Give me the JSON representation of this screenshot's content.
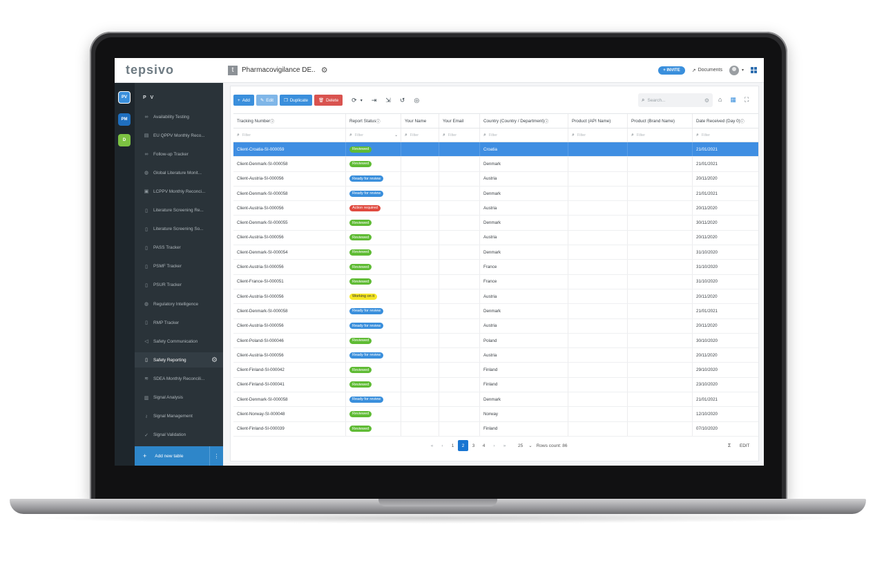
{
  "app": {
    "logo": "tepsivo",
    "badge_letter": "t",
    "title": "Pharmacovigilance DE..",
    "invite_label": "+ INVITE",
    "documents_label": "Documents"
  },
  "rail": [
    {
      "label": "PV",
      "color": "#3a8fdc"
    },
    {
      "label": "PM",
      "color": "#1f6fbf"
    },
    {
      "label": "D",
      "color": "#7cc242"
    }
  ],
  "sidebar": {
    "heading": "P V",
    "items": [
      {
        "label": "Availability Testing",
        "icon": "link-icon"
      },
      {
        "label": "EU QPPV Monthly Reco...",
        "icon": "table-icon"
      },
      {
        "label": "Follow-up Tracker",
        "icon": "link-icon"
      },
      {
        "label": "Global Literature Monit...",
        "icon": "globe-icon"
      },
      {
        "label": "LCPPV Monthly Reconci...",
        "icon": "calendar-icon"
      },
      {
        "label": "Literature Screening Re...",
        "icon": "document-icon"
      },
      {
        "label": "Literature Screening So...",
        "icon": "document-icon"
      },
      {
        "label": "PASS Tracker",
        "icon": "document-icon"
      },
      {
        "label": "PSMF Tracker",
        "icon": "document-icon"
      },
      {
        "label": "PSUR Tracker",
        "icon": "document-icon"
      },
      {
        "label": "Regulatory Intelligence",
        "icon": "globe-icon"
      },
      {
        "label": "RMP Tracker",
        "icon": "document-icon"
      },
      {
        "label": "Safety Communication",
        "icon": "megaphone-icon"
      },
      {
        "label": "Safety Reporting",
        "icon": "document-icon",
        "active": true
      },
      {
        "label": "SDEA Monthly Reconcili...",
        "icon": "handshake-icon"
      },
      {
        "label": "Signal Analysis",
        "icon": "chart-icon"
      },
      {
        "label": "Signal Management",
        "icon": "signal-icon"
      },
      {
        "label": "Signal Validation",
        "icon": "check-icon"
      }
    ],
    "add_table_label": "Add new table"
  },
  "toolbar": {
    "add": "Add",
    "edit": "Edit",
    "duplicate": "Duplicate",
    "delete": "Delete"
  },
  "search": {
    "placeholder": "Search..."
  },
  "table": {
    "columns": [
      "Tracking Number",
      "Report Status",
      "Your Name",
      "Your Email",
      "Country (Country / Department)",
      "Product (API Name)",
      "Product (Brand Name)",
      "Date Received (Day 0)"
    ],
    "filter_placeholder": "Filter",
    "rows": [
      {
        "tracking": "Client-Croatia-SI-000059",
        "status": "Reviewed",
        "country": "Croatia",
        "date": "21/01/2021",
        "selected": true
      },
      {
        "tracking": "Client-Denmark-SI-000058",
        "status": "Reviewed",
        "country": "Denmark",
        "date": "21/01/2021"
      },
      {
        "tracking": "Client-Austria-SI-000056",
        "status": "Ready for review",
        "country": "Austria",
        "date": "20/11/2020"
      },
      {
        "tracking": "Client-Denmark-SI-000058",
        "status": "Ready for review",
        "country": "Denmark",
        "date": "21/01/2021"
      },
      {
        "tracking": "Client-Austria-SI-000056",
        "status": "Action required",
        "country": "Austria",
        "date": "20/11/2020"
      },
      {
        "tracking": "Client-Denmark-SI-000055",
        "status": "Reviewed",
        "country": "Denmark",
        "date": "30/11/2020"
      },
      {
        "tracking": "Client-Austria-SI-000056",
        "status": "Reviewed",
        "country": "Austria",
        "date": "20/11/2020"
      },
      {
        "tracking": "Client-Denmark-SI-000054",
        "status": "Reviewed",
        "country": "Denmark",
        "date": "31/10/2020"
      },
      {
        "tracking": "Client-Austria-SI-000056",
        "status": "Reviewed",
        "country": "France",
        "date": "31/10/2020"
      },
      {
        "tracking": "Client-France-SI-000051",
        "status": "Reviewed",
        "country": "France",
        "date": "31/10/2020"
      },
      {
        "tracking": "Client-Austria-SI-000056",
        "status": "Working on it",
        "country": "Austria",
        "date": "20/11/2020"
      },
      {
        "tracking": "Client-Denmark-SI-000058",
        "status": "Ready for review",
        "country": "Denmark",
        "date": "21/01/2021"
      },
      {
        "tracking": "Client-Austria-SI-000056",
        "status": "Ready for review",
        "country": "Austria",
        "date": "20/11/2020"
      },
      {
        "tracking": "Client-Poland-SI-000046",
        "status": "Reviewed",
        "country": "Poland",
        "date": "30/10/2020"
      },
      {
        "tracking": "Client-Austria-SI-000056",
        "status": "Ready for review",
        "country": "Austria",
        "date": "20/11/2020"
      },
      {
        "tracking": "Client-Finland-SI-000042",
        "status": "Reviewed",
        "country": "Finland",
        "date": "29/10/2020"
      },
      {
        "tracking": "Client-Finland-SI-000041",
        "status": "Reviewed",
        "country": "Finland",
        "date": "23/10/2020"
      },
      {
        "tracking": "Client-Denmark-SI-000058",
        "status": "Ready for review",
        "country": "Denmark",
        "date": "21/01/2021"
      },
      {
        "tracking": "Client-Norway-SI-000048",
        "status": "Reviewed",
        "country": "Norway",
        "date": "12/10/2020"
      },
      {
        "tracking": "Client-Finland-SI-000039",
        "status": "Reviewed",
        "country": "Finland",
        "date": "07/10/2020"
      }
    ]
  },
  "status_colors": {
    "Reviewed": "#5fbb34",
    "Ready for review": "#3a8fdc",
    "Action required": "#e04a3f",
    "Working on it": "#f6e727"
  },
  "pagination": {
    "pages": [
      "1",
      "2",
      "3",
      "4"
    ],
    "current": "2",
    "rows_per_page": "25",
    "rows_count_label": "Rows count: 86",
    "sigma": "Σ",
    "edit_label": "EDIT"
  }
}
